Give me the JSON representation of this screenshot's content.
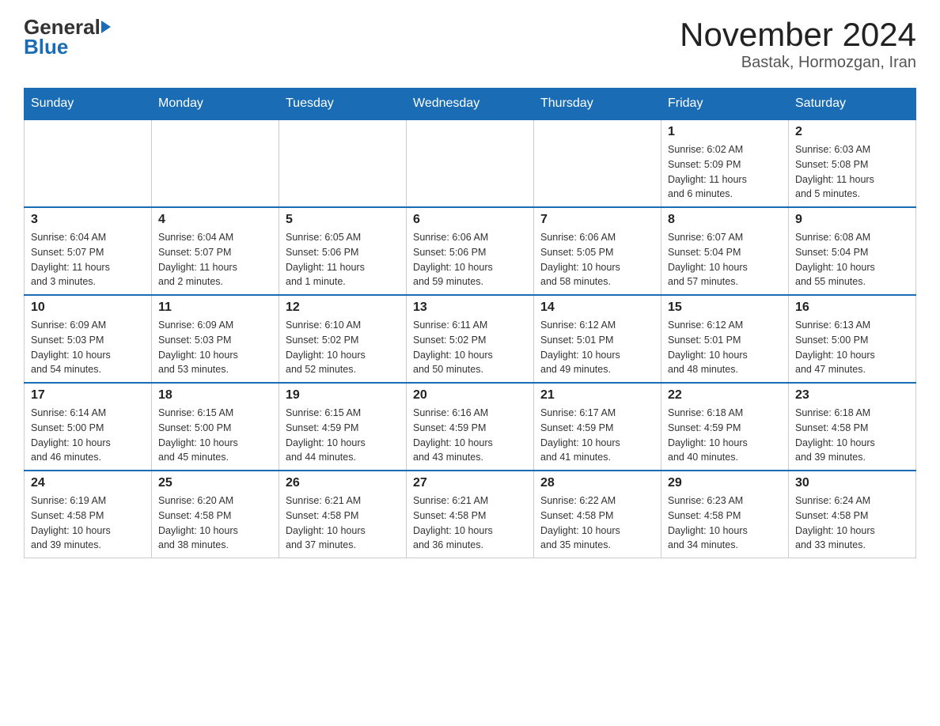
{
  "header": {
    "logo_general": "General",
    "logo_blue": "Blue",
    "title": "November 2024",
    "subtitle": "Bastak, Hormozgan, Iran"
  },
  "weekdays": [
    "Sunday",
    "Monday",
    "Tuesday",
    "Wednesday",
    "Thursday",
    "Friday",
    "Saturday"
  ],
  "weeks": [
    [
      {
        "day": "",
        "info": ""
      },
      {
        "day": "",
        "info": ""
      },
      {
        "day": "",
        "info": ""
      },
      {
        "day": "",
        "info": ""
      },
      {
        "day": "",
        "info": ""
      },
      {
        "day": "1",
        "info": "Sunrise: 6:02 AM\nSunset: 5:09 PM\nDaylight: 11 hours\nand 6 minutes."
      },
      {
        "day": "2",
        "info": "Sunrise: 6:03 AM\nSunset: 5:08 PM\nDaylight: 11 hours\nand 5 minutes."
      }
    ],
    [
      {
        "day": "3",
        "info": "Sunrise: 6:04 AM\nSunset: 5:07 PM\nDaylight: 11 hours\nand 3 minutes."
      },
      {
        "day": "4",
        "info": "Sunrise: 6:04 AM\nSunset: 5:07 PM\nDaylight: 11 hours\nand 2 minutes."
      },
      {
        "day": "5",
        "info": "Sunrise: 6:05 AM\nSunset: 5:06 PM\nDaylight: 11 hours\nand 1 minute."
      },
      {
        "day": "6",
        "info": "Sunrise: 6:06 AM\nSunset: 5:06 PM\nDaylight: 10 hours\nand 59 minutes."
      },
      {
        "day": "7",
        "info": "Sunrise: 6:06 AM\nSunset: 5:05 PM\nDaylight: 10 hours\nand 58 minutes."
      },
      {
        "day": "8",
        "info": "Sunrise: 6:07 AM\nSunset: 5:04 PM\nDaylight: 10 hours\nand 57 minutes."
      },
      {
        "day": "9",
        "info": "Sunrise: 6:08 AM\nSunset: 5:04 PM\nDaylight: 10 hours\nand 55 minutes."
      }
    ],
    [
      {
        "day": "10",
        "info": "Sunrise: 6:09 AM\nSunset: 5:03 PM\nDaylight: 10 hours\nand 54 minutes."
      },
      {
        "day": "11",
        "info": "Sunrise: 6:09 AM\nSunset: 5:03 PM\nDaylight: 10 hours\nand 53 minutes."
      },
      {
        "day": "12",
        "info": "Sunrise: 6:10 AM\nSunset: 5:02 PM\nDaylight: 10 hours\nand 52 minutes."
      },
      {
        "day": "13",
        "info": "Sunrise: 6:11 AM\nSunset: 5:02 PM\nDaylight: 10 hours\nand 50 minutes."
      },
      {
        "day": "14",
        "info": "Sunrise: 6:12 AM\nSunset: 5:01 PM\nDaylight: 10 hours\nand 49 minutes."
      },
      {
        "day": "15",
        "info": "Sunrise: 6:12 AM\nSunset: 5:01 PM\nDaylight: 10 hours\nand 48 minutes."
      },
      {
        "day": "16",
        "info": "Sunrise: 6:13 AM\nSunset: 5:00 PM\nDaylight: 10 hours\nand 47 minutes."
      }
    ],
    [
      {
        "day": "17",
        "info": "Sunrise: 6:14 AM\nSunset: 5:00 PM\nDaylight: 10 hours\nand 46 minutes."
      },
      {
        "day": "18",
        "info": "Sunrise: 6:15 AM\nSunset: 5:00 PM\nDaylight: 10 hours\nand 45 minutes."
      },
      {
        "day": "19",
        "info": "Sunrise: 6:15 AM\nSunset: 4:59 PM\nDaylight: 10 hours\nand 44 minutes."
      },
      {
        "day": "20",
        "info": "Sunrise: 6:16 AM\nSunset: 4:59 PM\nDaylight: 10 hours\nand 43 minutes."
      },
      {
        "day": "21",
        "info": "Sunrise: 6:17 AM\nSunset: 4:59 PM\nDaylight: 10 hours\nand 41 minutes."
      },
      {
        "day": "22",
        "info": "Sunrise: 6:18 AM\nSunset: 4:59 PM\nDaylight: 10 hours\nand 40 minutes."
      },
      {
        "day": "23",
        "info": "Sunrise: 6:18 AM\nSunset: 4:58 PM\nDaylight: 10 hours\nand 39 minutes."
      }
    ],
    [
      {
        "day": "24",
        "info": "Sunrise: 6:19 AM\nSunset: 4:58 PM\nDaylight: 10 hours\nand 39 minutes."
      },
      {
        "day": "25",
        "info": "Sunrise: 6:20 AM\nSunset: 4:58 PM\nDaylight: 10 hours\nand 38 minutes."
      },
      {
        "day": "26",
        "info": "Sunrise: 6:21 AM\nSunset: 4:58 PM\nDaylight: 10 hours\nand 37 minutes."
      },
      {
        "day": "27",
        "info": "Sunrise: 6:21 AM\nSunset: 4:58 PM\nDaylight: 10 hours\nand 36 minutes."
      },
      {
        "day": "28",
        "info": "Sunrise: 6:22 AM\nSunset: 4:58 PM\nDaylight: 10 hours\nand 35 minutes."
      },
      {
        "day": "29",
        "info": "Sunrise: 6:23 AM\nSunset: 4:58 PM\nDaylight: 10 hours\nand 34 minutes."
      },
      {
        "day": "30",
        "info": "Sunrise: 6:24 AM\nSunset: 4:58 PM\nDaylight: 10 hours\nand 33 minutes."
      }
    ]
  ]
}
